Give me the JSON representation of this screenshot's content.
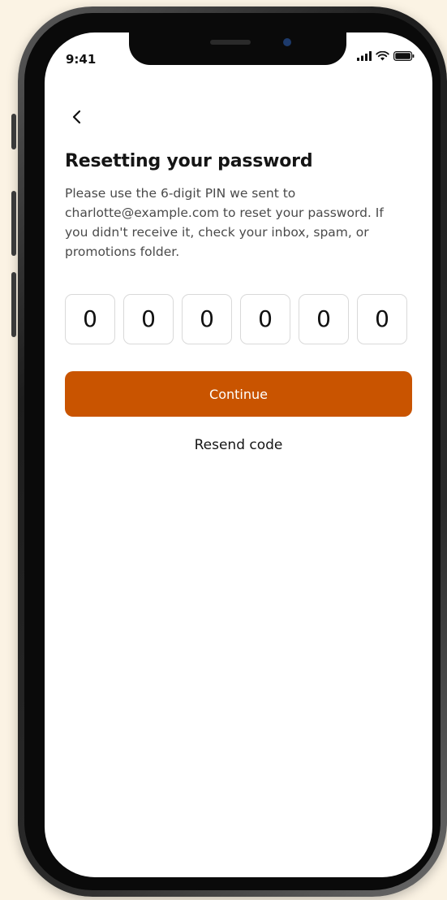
{
  "status_bar": {
    "time": "9:41",
    "icons": [
      "signal-icon",
      "wifi-icon",
      "battery-icon"
    ]
  },
  "header": {
    "back_icon": "chevron-left-icon"
  },
  "main": {
    "title": "Resetting your password",
    "description": "Please use the 6-digit PIN we sent to charlotte@example.com to reset your password. If you didn't receive it, check your inbox, spam, or promotions folder.",
    "pin_digits": [
      "0",
      "0",
      "0",
      "0",
      "0",
      "0"
    ],
    "continue_label": "Continue",
    "resend_label": "Resend code"
  },
  "colors": {
    "accent": "#c95400",
    "background": "#fbf3e4",
    "screen": "#ffffff",
    "pin_border": "#d9d9d9"
  }
}
